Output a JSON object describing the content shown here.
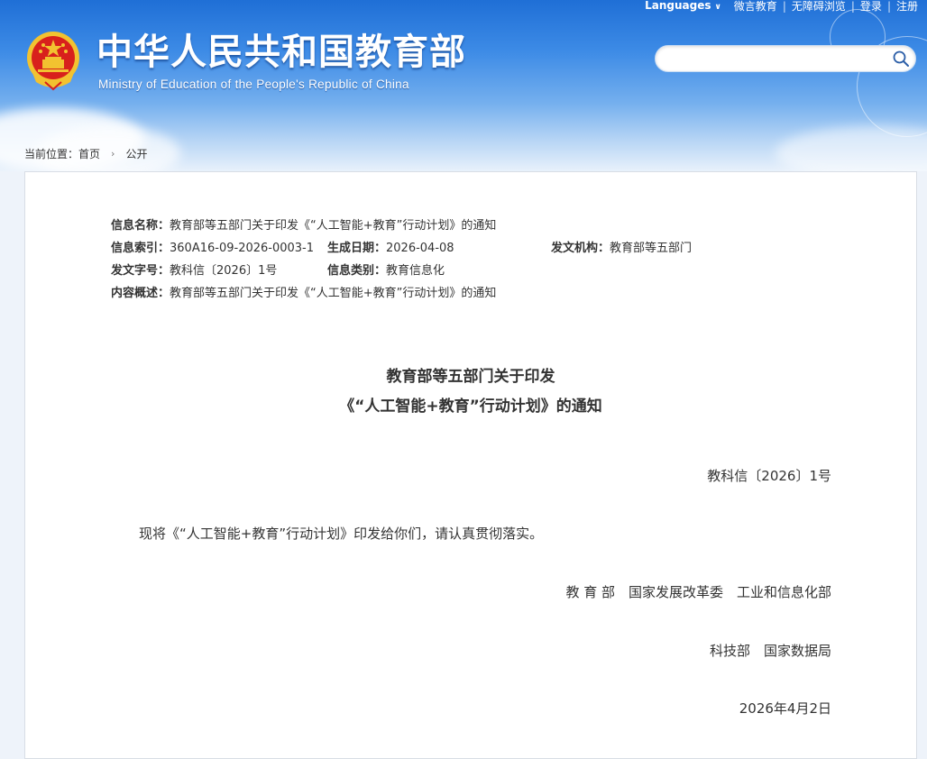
{
  "topnav": {
    "languages": "Languages",
    "weibo": "微言教育",
    "accessible": "无障碍浏览",
    "login": "登录",
    "register": "注册",
    "separator": "|"
  },
  "site": {
    "title": "中华人民共和国教育部",
    "subtitle": "Ministry of Education of the People's Republic of China"
  },
  "search": {
    "placeholder": "",
    "value": ""
  },
  "breadcrumb": {
    "prefix": "当前位置：",
    "home": "首页",
    "current": "公开"
  },
  "meta": {
    "name_label": "信息名称：",
    "name_value": "教育部等五部门关于印发《“人工智能+教育”行动计划》的通知",
    "index_label": "信息索引：",
    "index_value": "360A16-09-2026-0003-1",
    "date_label": "生成日期：",
    "date_value": "2026-04-08",
    "org_label": "发文机构：",
    "org_value": "教育部等五部门",
    "docno_label": "发文字号：",
    "docno_value": "教科信〔2026〕1号",
    "category_label": "信息类别：",
    "category_value": "教育信息化",
    "summary_label": "内容概述：",
    "summary_value": "教育部等五部门关于印发《“人工智能+教育”行动计划》的通知"
  },
  "document": {
    "title_line1": "教育部等五部门关于印发",
    "title_line2": "《“人工智能+教育”行动计划》的通知",
    "number": "教科信〔2026〕1号",
    "body": "现将《“人工智能+教育”行动计划》印发给你们，请认真贯彻落实。",
    "signers_line1": "教 育 部　国家发展改革委　工业和信息化部",
    "signers_line2": "科技部　国家数据局",
    "date": "2026年4月2日"
  },
  "colors": {
    "header_blue": "#1f6fd6",
    "emblem_red": "#d8201c",
    "emblem_gold": "#f2c230",
    "text": "#333333"
  }
}
